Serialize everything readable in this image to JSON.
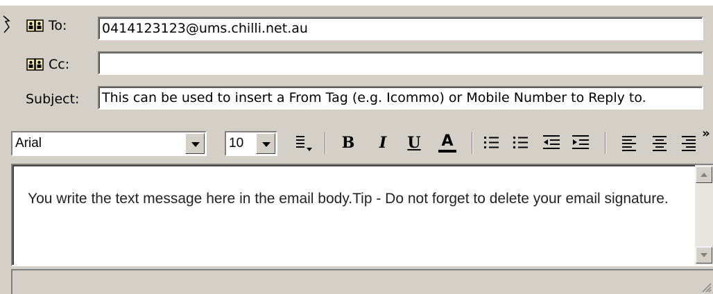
{
  "header": {
    "to_label": "To:",
    "to_value": "0414123123@ums.chilli.net.au",
    "cc_label": "Cc:",
    "cc_value": "",
    "subject_label": "Subject:",
    "subject_value": "This can be used to insert a From Tag (e.g. Icommo) or Mobile Number to Reply to."
  },
  "toolbar": {
    "font_name": "Arial",
    "font_size": "10",
    "bold_label": "B",
    "italic_label": "I",
    "underline_label": "U",
    "font_color_label": "A",
    "overflow_label": "»",
    "icons": [
      "style-icon",
      "bold-icon",
      "italic-icon",
      "underline-icon",
      "font-color-icon",
      "numbered-list-icon",
      "bullet-list-icon",
      "decrease-indent-icon",
      "increase-indent-icon",
      "align-left-icon",
      "align-center-icon",
      "align-right-icon",
      "toolbar-overflow-icon"
    ]
  },
  "body": {
    "text": "You write the text message here in the email body.Tip - Do not forget to delete your email signature."
  },
  "colors": {
    "chrome": "#d4d0c8",
    "field_bg": "#ffffff",
    "font_color_bar": "#000000"
  }
}
